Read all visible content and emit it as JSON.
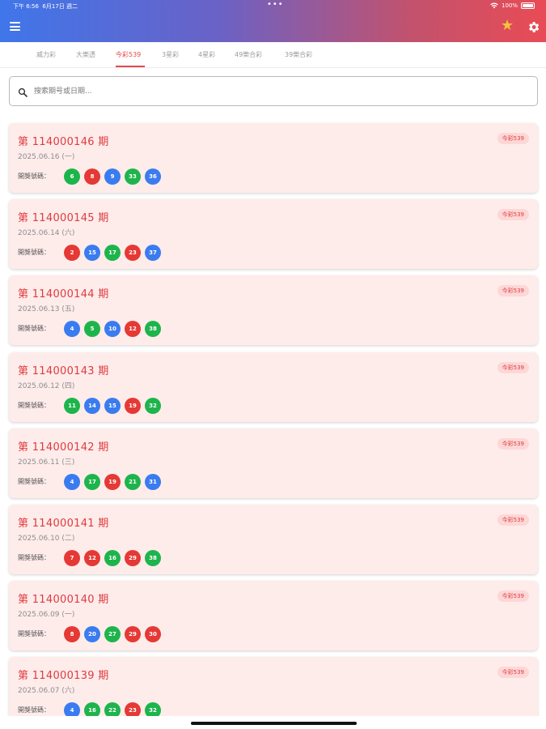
{
  "status_bar": {
    "time": "下午 6:56",
    "date": "6月17日 週二",
    "dots": "•••",
    "battery": "100%"
  },
  "tabs": [
    {
      "label": "威力彩",
      "active": false
    },
    {
      "label": "大樂透",
      "active": false
    },
    {
      "label": "今彩539",
      "active": true
    },
    {
      "label": "3星彩",
      "active": false
    },
    {
      "label": "4星彩",
      "active": false
    },
    {
      "label": "49樂合彩",
      "active": false
    },
    {
      "label": "39樂合彩",
      "active": false
    }
  ],
  "search": {
    "placeholder": "搜索期号或日期..."
  },
  "draws": [
    {
      "title": "第 114000146 期",
      "date": "2025.06.16 (一)",
      "badge": "今彩539",
      "label": "開獎號碼：",
      "balls": [
        {
          "n": "6",
          "c": "green"
        },
        {
          "n": "8",
          "c": "red"
        },
        {
          "n": "9",
          "c": "blue"
        },
        {
          "n": "33",
          "c": "green"
        },
        {
          "n": "36",
          "c": "blue"
        }
      ]
    },
    {
      "title": "第 114000145 期",
      "date": "2025.06.14 (六)",
      "badge": "今彩539",
      "label": "開獎號碼：",
      "balls": [
        {
          "n": "2",
          "c": "red"
        },
        {
          "n": "15",
          "c": "blue"
        },
        {
          "n": "17",
          "c": "green"
        },
        {
          "n": "23",
          "c": "red"
        },
        {
          "n": "37",
          "c": "blue"
        }
      ]
    },
    {
      "title": "第 114000144 期",
      "date": "2025.06.13 (五)",
      "badge": "今彩539",
      "label": "開獎號碼：",
      "balls": [
        {
          "n": "4",
          "c": "blue"
        },
        {
          "n": "5",
          "c": "green"
        },
        {
          "n": "10",
          "c": "blue"
        },
        {
          "n": "12",
          "c": "red"
        },
        {
          "n": "38",
          "c": "green"
        }
      ]
    },
    {
      "title": "第 114000143 期",
      "date": "2025.06.12 (四)",
      "badge": "今彩539",
      "label": "開獎號碼：",
      "balls": [
        {
          "n": "11",
          "c": "green"
        },
        {
          "n": "14",
          "c": "blue"
        },
        {
          "n": "15",
          "c": "blue"
        },
        {
          "n": "19",
          "c": "red"
        },
        {
          "n": "32",
          "c": "green"
        }
      ]
    },
    {
      "title": "第 114000142 期",
      "date": "2025.06.11 (三)",
      "badge": "今彩539",
      "label": "開獎號碼：",
      "balls": [
        {
          "n": "4",
          "c": "blue"
        },
        {
          "n": "17",
          "c": "green"
        },
        {
          "n": "19",
          "c": "red"
        },
        {
          "n": "21",
          "c": "green"
        },
        {
          "n": "31",
          "c": "blue"
        }
      ]
    },
    {
      "title": "第 114000141 期",
      "date": "2025.06.10 (二)",
      "badge": "今彩539",
      "label": "開獎號碼：",
      "balls": [
        {
          "n": "7",
          "c": "red"
        },
        {
          "n": "12",
          "c": "red"
        },
        {
          "n": "16",
          "c": "green"
        },
        {
          "n": "29",
          "c": "red"
        },
        {
          "n": "38",
          "c": "green"
        }
      ]
    },
    {
      "title": "第 114000140 期",
      "date": "2025.06.09 (一)",
      "badge": "今彩539",
      "label": "開獎號碼：",
      "balls": [
        {
          "n": "8",
          "c": "red"
        },
        {
          "n": "20",
          "c": "blue"
        },
        {
          "n": "27",
          "c": "green"
        },
        {
          "n": "29",
          "c": "red"
        },
        {
          "n": "30",
          "c": "red"
        }
      ]
    },
    {
      "title": "第 114000139 期",
      "date": "2025.06.07 (六)",
      "badge": "今彩539",
      "label": "開獎號碼：",
      "balls": [
        {
          "n": "4",
          "c": "blue"
        },
        {
          "n": "16",
          "c": "green"
        },
        {
          "n": "22",
          "c": "green"
        },
        {
          "n": "23",
          "c": "red"
        },
        {
          "n": "32",
          "c": "green"
        }
      ]
    }
  ],
  "colors": {
    "accent": "#e5484d",
    "card_bg": "#feeceb",
    "ball_green": "#1eb44c",
    "ball_red": "#e53935",
    "ball_blue": "#3a7cef"
  },
  "icons": {
    "menu": "menu-icon",
    "favorite": "star-icon",
    "settings": "gear-icon",
    "search": "search-icon"
  }
}
